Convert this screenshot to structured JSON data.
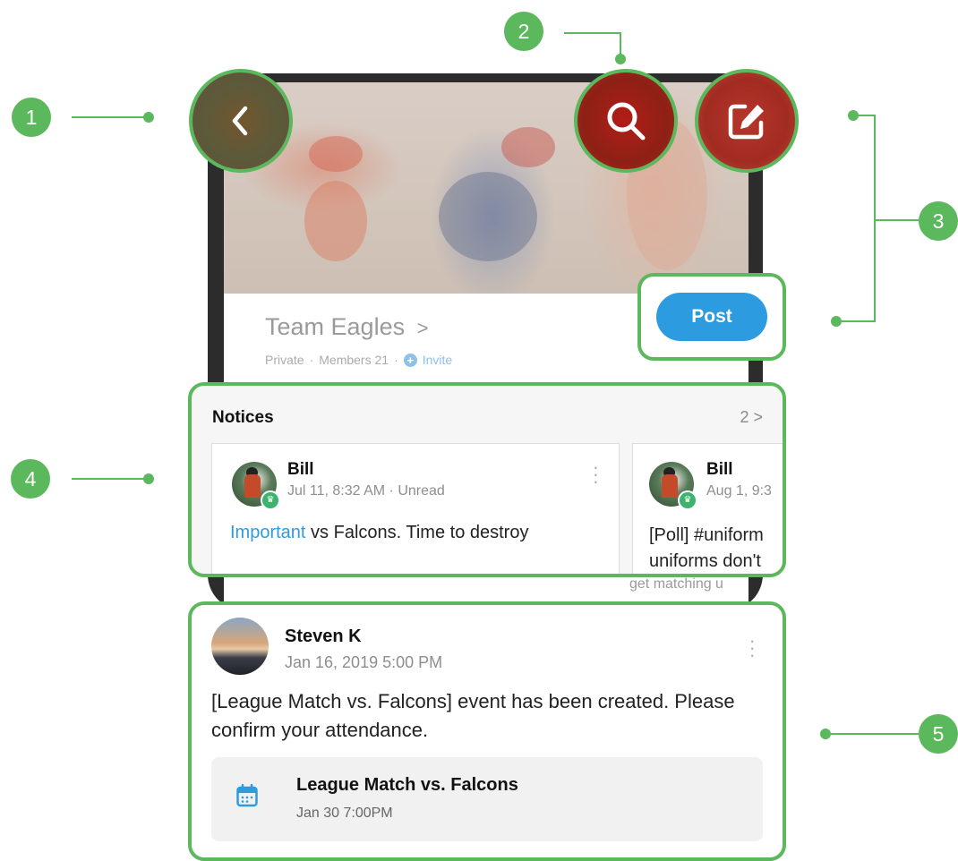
{
  "team": {
    "name": "Team Eagles",
    "name_chevron": ">",
    "privacy": "Private",
    "separator": "·",
    "members": "Members 21",
    "invite_label": "Invite"
  },
  "actions": {
    "back_icon": "chevron-left-icon",
    "search_icon": "search-icon",
    "edit_icon": "edit-icon",
    "post_label": "Post"
  },
  "notices": {
    "title": "Notices",
    "count": "2 >",
    "items": [
      {
        "author": "Bill",
        "meta": "Jul 11, 8:32 AM · Unread",
        "tag": "Important",
        "text": " vs Falcons. Time to destroy"
      },
      {
        "author": "Bill",
        "meta": "Aug 1, 9:3",
        "text": "[Poll] #uniform uniforms don't",
        "faded_text": "get matching u"
      }
    ]
  },
  "feed": {
    "author": "Steven K",
    "time": "Jan 16, 2019 5:00 PM",
    "text": "[League Match vs. Falcons] event has been created. Please confirm your attendance.",
    "event": {
      "icon": "calendar-icon",
      "title": "League Match vs. Falcons",
      "date": "Jan 30 7:00PM"
    }
  },
  "callouts": [
    "1",
    "2",
    "3",
    "4",
    "5"
  ],
  "colors": {
    "callout_green": "#5cb85c",
    "post_blue": "#2d9be0",
    "important_blue": "#2d9be0"
  }
}
